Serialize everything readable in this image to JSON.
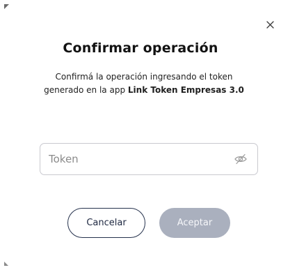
{
  "dialog": {
    "title": "Confirmar operación",
    "description_prefix": "Confirmá la operación ingresando el token generado en la app ",
    "description_app": "Link Token Empresas 3.0",
    "close_icon": "close-icon"
  },
  "token_field": {
    "placeholder": "Token",
    "value": "",
    "visibility_icon": "eye-off-icon"
  },
  "buttons": {
    "cancel_label": "Cancelar",
    "accept_label": "Aceptar",
    "accept_enabled": false
  },
  "colors": {
    "primary_dark": "#26324d",
    "disabled_button": "#aab0be",
    "field_border": "#c9c9cf"
  }
}
